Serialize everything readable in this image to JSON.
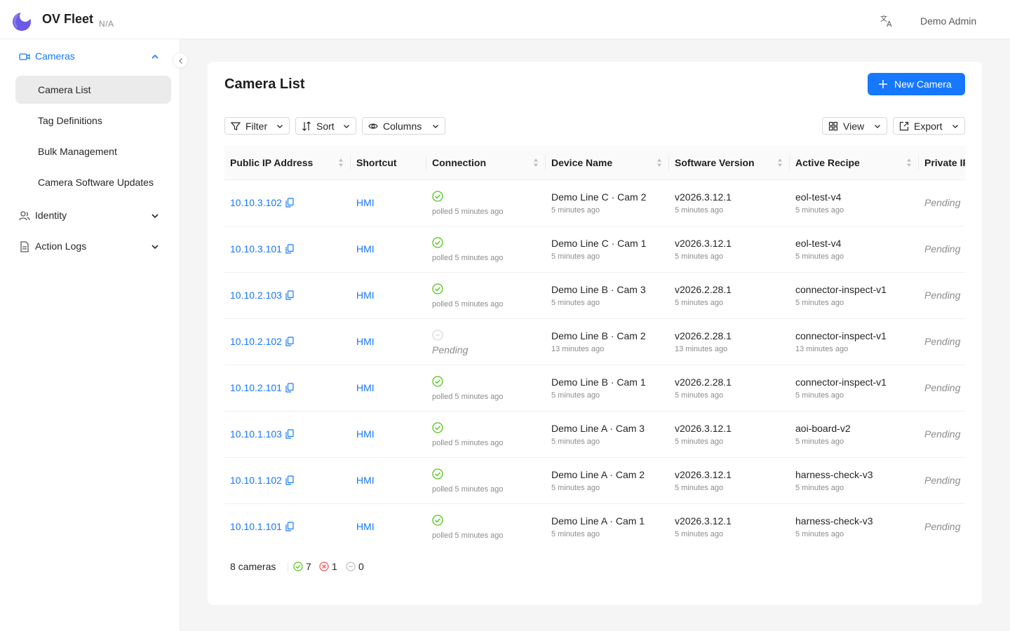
{
  "app": {
    "title": "OV Fleet",
    "subtitle": "N/A",
    "user": "Demo Admin"
  },
  "colors": {
    "accent": "#1677ff",
    "success": "#52c41a",
    "error": "#ff4d4f",
    "muted": "#bfbfbf"
  },
  "sidebar": {
    "cameras": {
      "label": "Cameras",
      "icon": "video-camera-icon",
      "expanded": true
    },
    "items": [
      {
        "label": "Camera List",
        "selected": true
      },
      {
        "label": "Tag Definitions"
      },
      {
        "label": "Bulk Management"
      },
      {
        "label": "Camera Software Updates"
      }
    ],
    "identity": {
      "label": "Identity",
      "icon": "user-group-icon"
    },
    "action_logs": {
      "label": "Action Logs",
      "icon": "document-icon"
    }
  },
  "main": {
    "title": "Camera List",
    "new_button": "New Camera",
    "toolbar": {
      "filter": "Filter",
      "sort": "Sort",
      "columns": "Columns",
      "view": "View",
      "export": "Export"
    },
    "columns": [
      "Public IP Address",
      "Shortcut",
      "Connection",
      "Device Name",
      "Software Version",
      "Active Recipe",
      "Private IP"
    ],
    "rows": [
      {
        "ip": "10.10.3.102",
        "shortcut": "HMI",
        "status": "ok",
        "conn_text": "polled 5 minutes ago",
        "device": "Demo Line C · Cam 2",
        "device_time": "5 minutes ago",
        "version": "v2026.3.12.1",
        "version_time": "5 minutes ago",
        "recipe": "eol-test-v4",
        "recipe_time": "5 minutes ago",
        "private_ip": "Pending"
      },
      {
        "ip": "10.10.3.101",
        "shortcut": "HMI",
        "status": "ok",
        "conn_text": "polled 5 minutes ago",
        "device": "Demo Line C · Cam 1",
        "device_time": "5 minutes ago",
        "version": "v2026.3.12.1",
        "version_time": "5 minutes ago",
        "recipe": "eol-test-v4",
        "recipe_time": "5 minutes ago",
        "private_ip": "Pending"
      },
      {
        "ip": "10.10.2.103",
        "shortcut": "HMI",
        "status": "ok",
        "conn_text": "polled 5 minutes ago",
        "device": "Demo Line B · Cam 3",
        "device_time": "5 minutes ago",
        "version": "v2026.2.28.1",
        "version_time": "5 minutes ago",
        "recipe": "connector-inspect-v1",
        "recipe_time": "5 minutes ago",
        "private_ip": "Pending"
      },
      {
        "ip": "10.10.2.102",
        "shortcut": "HMI",
        "status": "pending",
        "conn_text": "Pending",
        "device": "Demo Line B · Cam 2",
        "device_time": "13 minutes ago",
        "version": "v2026.2.28.1",
        "version_time": "13 minutes ago",
        "recipe": "connector-inspect-v1",
        "recipe_time": "13 minutes ago",
        "private_ip": "Pending"
      },
      {
        "ip": "10.10.2.101",
        "shortcut": "HMI",
        "status": "ok",
        "conn_text": "polled 5 minutes ago",
        "device": "Demo Line B · Cam 1",
        "device_time": "5 minutes ago",
        "version": "v2026.2.28.1",
        "version_time": "5 minutes ago",
        "recipe": "connector-inspect-v1",
        "recipe_time": "5 minutes ago",
        "private_ip": "Pending"
      },
      {
        "ip": "10.10.1.103",
        "shortcut": "HMI",
        "status": "ok",
        "conn_text": "polled 5 minutes ago",
        "device": "Demo Line A · Cam 3",
        "device_time": "5 minutes ago",
        "version": "v2026.3.12.1",
        "version_time": "5 minutes ago",
        "recipe": "aoi-board-v2",
        "recipe_time": "5 minutes ago",
        "private_ip": "Pending"
      },
      {
        "ip": "10.10.1.102",
        "shortcut": "HMI",
        "status": "ok",
        "conn_text": "polled 5 minutes ago",
        "device": "Demo Line A · Cam 2",
        "device_time": "5 minutes ago",
        "version": "v2026.3.12.1",
        "version_time": "5 minutes ago",
        "recipe": "harness-check-v3",
        "recipe_time": "5 minutes ago",
        "private_ip": "Pending"
      },
      {
        "ip": "10.10.1.101",
        "shortcut": "HMI",
        "status": "ok",
        "conn_text": "polled 5 minutes ago",
        "device": "Demo Line A · Cam 1",
        "device_time": "5 minutes ago",
        "version": "v2026.3.12.1",
        "version_time": "5 minutes ago",
        "recipe": "harness-check-v3",
        "recipe_time": "5 minutes ago",
        "private_ip": "Pending"
      }
    ],
    "footer": {
      "count": "8 cameras",
      "online": "7",
      "offline": "1",
      "unknown": "0"
    }
  }
}
